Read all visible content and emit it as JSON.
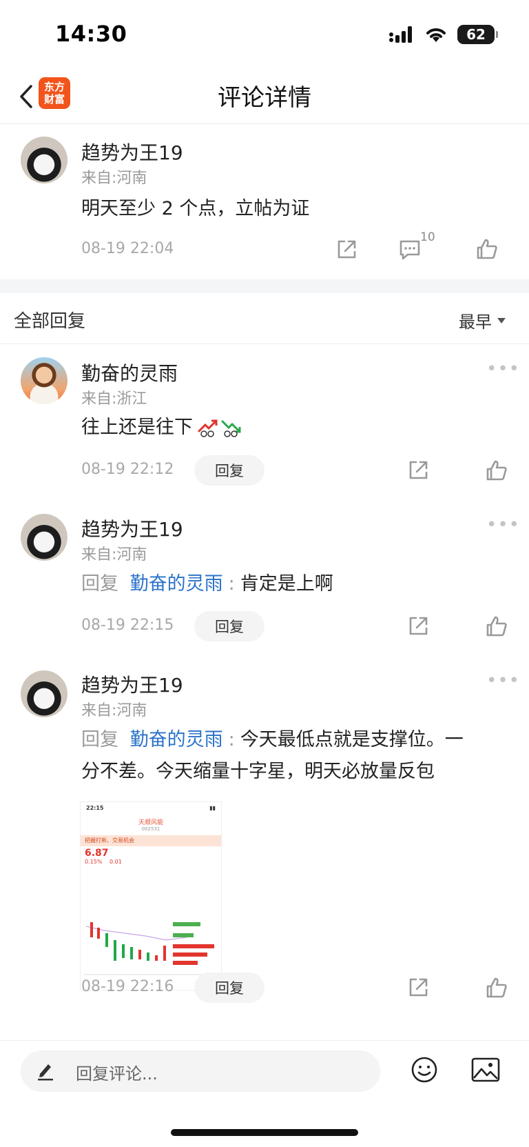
{
  "status_bar": {
    "time": "14:30",
    "battery": "62"
  },
  "nav": {
    "title": "评论详情",
    "logo_line1": "东方",
    "logo_line2": "财富"
  },
  "main_comment": {
    "username": "趋势为王19",
    "location": "来自:河南",
    "text": "明天至少 2 个点，立帖为证",
    "time": "08-19 22:04",
    "comment_count": "10"
  },
  "replies_section": {
    "title": "全部回复",
    "sort_label": "最早"
  },
  "replies": [
    {
      "username": "勤奋的灵雨",
      "location": "来自:浙江",
      "text": "往上还是往下",
      "time": "08-19 22:12",
      "reply_label": "回复"
    },
    {
      "username": "趋势为王19",
      "location": "来自:河南",
      "reply_prefix": "回复",
      "reply_to": "勤奋的灵雨",
      "colon": ":",
      "text": "肯定是上啊",
      "time": "08-19 22:15",
      "reply_label": "回复"
    },
    {
      "username": "趋势为王19",
      "location": "来自:河南",
      "reply_prefix": "回复",
      "reply_to": "勤奋的灵雨",
      "colon": ":",
      "text_line1": "今天最低点就是支撑位。一",
      "text_line2": "分不差。今天缩量十字星，明天必放量反包",
      "time": "08-19 22:16",
      "reply_label": "回复",
      "attachment": {
        "time": "22:15",
        "stock_name": "天顺风能",
        "stock_code": "002531",
        "banner": "把握打新、交易机会",
        "price": "6.87",
        "change": "0.15%",
        "change_abs": "0.01"
      }
    }
  ],
  "bottom_bar": {
    "placeholder": "回复评论..."
  }
}
